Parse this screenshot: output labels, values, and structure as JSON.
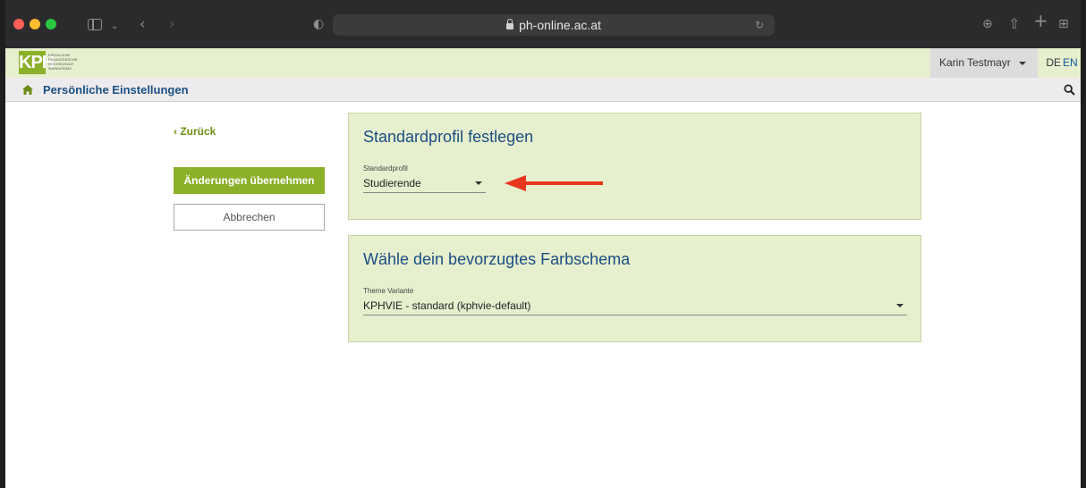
{
  "browser": {
    "url": "ph-online.ac.at"
  },
  "header": {
    "logo_text": "KPH",
    "logo_subtext": "KIRCHLICHE PÄDAGOGISCHE HOCHSCHULE WIEN/KREMS",
    "user_name": "Karin Testmayr",
    "lang_de": "DE",
    "lang_en": "EN"
  },
  "nav": {
    "title": "Persönliche Einstellungen"
  },
  "actions": {
    "back": "Zurück",
    "apply": "Änderungen übernehmen",
    "cancel": "Abbrechen"
  },
  "profile_panel": {
    "title": "Standardprofil festlegen",
    "field_label": "Standardprofil",
    "selected_value": "Studierende"
  },
  "theme_panel": {
    "title": "Wähle dein bevorzugtes Farbschema",
    "field_label": "Theme Variante",
    "selected_value": "KPHVIE - standard (kphvie-default)"
  },
  "colors": {
    "accent_green": "#8bb02a",
    "panel_bg": "#e6efce",
    "title_blue": "#1a4f83",
    "annotation_arrow": "#e8361f"
  }
}
